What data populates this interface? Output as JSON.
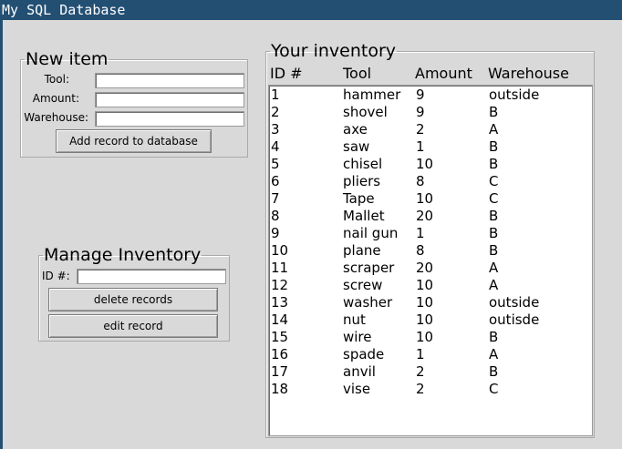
{
  "window": {
    "title": "My SQL Database"
  },
  "new_item": {
    "legend": "New item",
    "tool_label": "Tool:",
    "amount_label": "Amount:",
    "warehouse_label": "Warehouse:",
    "tool_value": "",
    "amount_value": "",
    "warehouse_value": "",
    "add_button": "Add record to database"
  },
  "manage": {
    "legend": "Manage Inventory",
    "id_label": "ID #:",
    "id_value": "",
    "delete_button": "delete records",
    "edit_button": "edit record"
  },
  "inventory": {
    "legend": "Your inventory",
    "columns": [
      "ID #",
      "Tool",
      "Amount",
      "Warehouse"
    ],
    "rows": [
      [
        "1",
        "hammer",
        "9",
        "outside"
      ],
      [
        "2",
        "shovel",
        "9",
        "B"
      ],
      [
        "3",
        "axe",
        "2",
        "A"
      ],
      [
        "4",
        "saw",
        "1",
        "B"
      ],
      [
        "5",
        "chisel",
        "10",
        "B"
      ],
      [
        "6",
        "pliers",
        "8",
        "C"
      ],
      [
        "7",
        "Tape",
        "10",
        "C"
      ],
      [
        "8",
        "Mallet",
        "20",
        "B"
      ],
      [
        "9",
        "nail gun",
        "1",
        "B"
      ],
      [
        "10",
        "plane",
        "8",
        "B"
      ],
      [
        "11",
        "scraper",
        "20",
        "A"
      ],
      [
        "12",
        "screw",
        "10",
        "A"
      ],
      [
        "13",
        "washer",
        "10",
        "outside"
      ],
      [
        "14",
        "nut",
        "10",
        "outisde"
      ],
      [
        "15",
        "wire",
        "10",
        "B"
      ],
      [
        "16",
        "spade",
        "1",
        "A"
      ],
      [
        "17",
        "anvil",
        "2",
        "B"
      ],
      [
        "18",
        "vise",
        "2",
        "C"
      ]
    ]
  },
  "colors": {
    "titlebar": "#234f73",
    "window_bg": "#d9d9d9"
  }
}
